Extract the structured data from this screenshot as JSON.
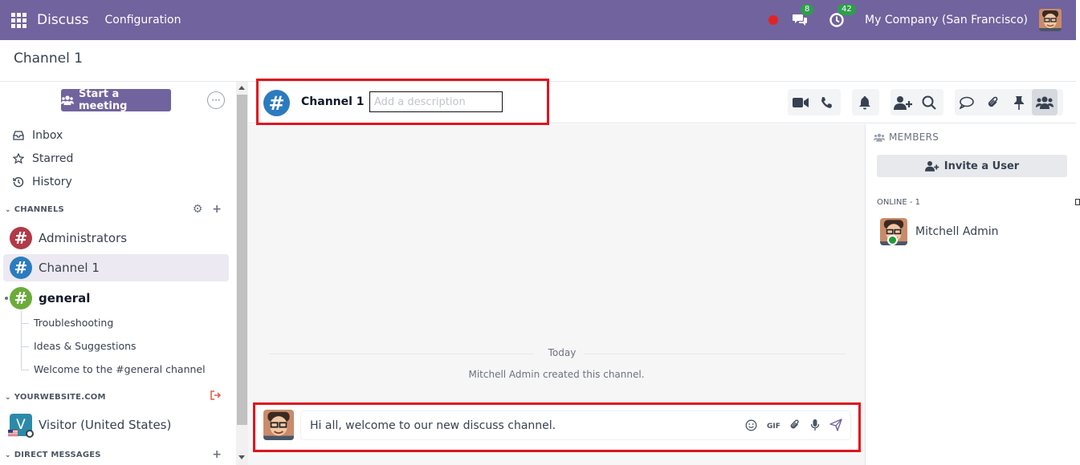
{
  "navbar": {
    "app_name": "Discuss",
    "menu": "Configuration",
    "messages_badge": "8",
    "activities_badge": "42",
    "company": "My Company (San Francisco)"
  },
  "breadcrumb": "Channel 1",
  "sidebar": {
    "start_meeting": "Start a meeting",
    "nav": [
      {
        "label": "Inbox",
        "icon": "inbox-icon"
      },
      {
        "label": "Starred",
        "icon": "star-icon"
      },
      {
        "label": "History",
        "icon": "history-icon"
      }
    ],
    "channels_header": "CHANNELS",
    "channels": [
      {
        "name": "Administrators",
        "color": "#b03a48"
      },
      {
        "name": "Channel 1",
        "color": "#2c7bbf"
      },
      {
        "name": "general",
        "color": "#6aab3a"
      }
    ],
    "threads": [
      "Troubleshooting",
      "Ideas & Suggestions",
      "Welcome to the #general channel"
    ],
    "livechat_header": "YOURWEBSITE.COM",
    "visitor": "Visitor (United States)",
    "visitor_initial": "V",
    "dm_header": "DIRECT MESSAGES"
  },
  "thread": {
    "title": "Channel 1",
    "description_placeholder": "Add a description"
  },
  "chat": {
    "date_separator": "Today",
    "notification": "Mitchell Admin created this channel.",
    "composer_text": "Hi all, welcome to our new discuss channel."
  },
  "members": {
    "title": "MEMBERS",
    "invite": "Invite a User",
    "online_label": "ONLINE - 1",
    "member_name": "Mitchell Admin"
  },
  "colors": {
    "brand": "#71639e",
    "highlight": "#e0141e",
    "online": "#1f9d3a"
  }
}
